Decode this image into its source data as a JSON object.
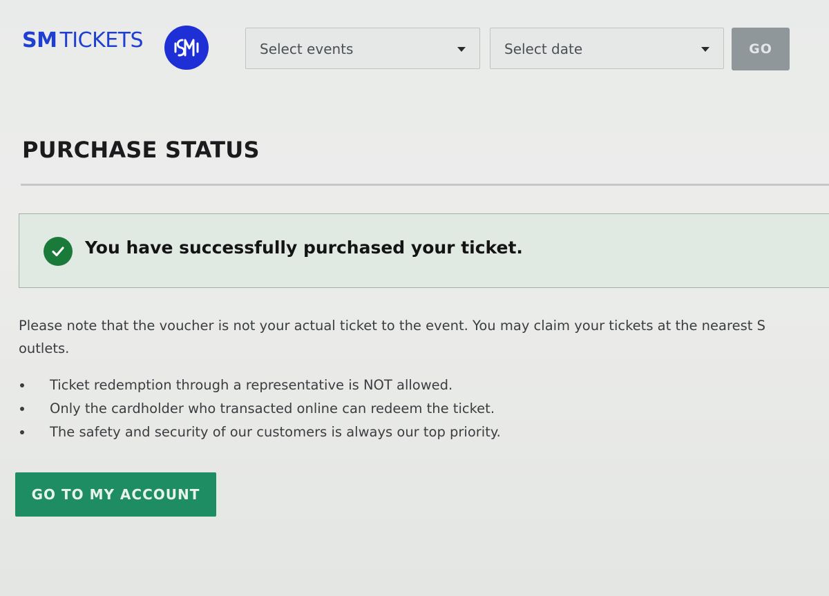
{
  "header": {
    "brand_sm": "SM",
    "brand_tickets": "TICKETS",
    "logo_icon": "sm-circle-logo",
    "events_select": {
      "value": "Select events"
    },
    "date_select": {
      "value": "Select date"
    },
    "go_label": "GO"
  },
  "page": {
    "title": "PURCHASE STATUS"
  },
  "alert": {
    "icon": "check-circle-icon",
    "message": "You have successfully purchased your ticket."
  },
  "notice": {
    "line1": "Please note that the voucher is not your actual ticket to the event. You may claim your tickets at the nearest S",
    "line2": "outlets.",
    "bullets": [
      "Ticket redemption through a representative is NOT allowed.",
      "Only the cardholder who transacted online can redeem the ticket.",
      "The safety and security of our customers is always our top priority."
    ]
  },
  "actions": {
    "account_label": "GO TO MY ACCOUNT"
  },
  "colors": {
    "brand_blue": "#1f3fd0",
    "success_green": "#1a7a3a",
    "button_green": "#1e8d63",
    "disabled_gray": "#8f979b"
  }
}
